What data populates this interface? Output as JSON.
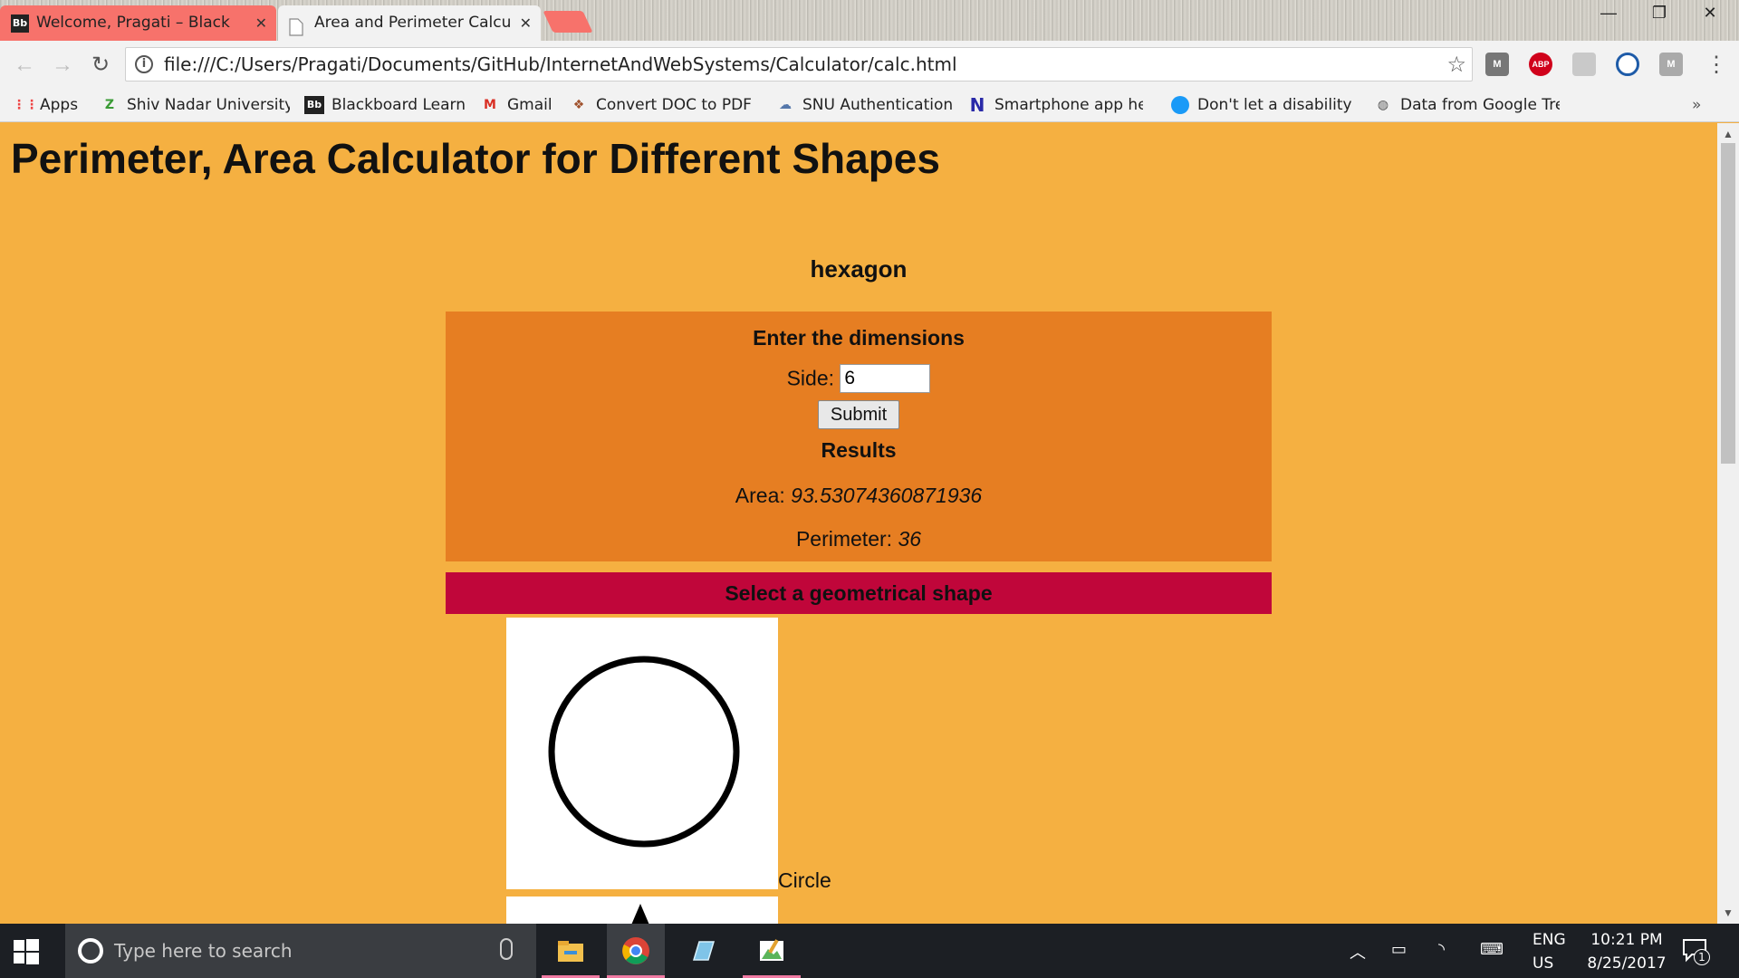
{
  "browser": {
    "tabs": [
      {
        "label": "Welcome, Pragati – Black",
        "favicon": "Bb"
      },
      {
        "label": "Area and Perimeter Calcu",
        "favicon": ""
      }
    ],
    "url": "file:///C:/Users/Pragati/Documents/GitHub/InternetAndWebSystems/Calculator/calc.html",
    "extensions": [
      "M",
      "ABP",
      "",
      "",
      "M"
    ],
    "bookmarks": [
      {
        "label": "Apps",
        "icon": "apps-grid-icon"
      },
      {
        "label": "Shiv Nadar University",
        "icon": "snu-logo-icon"
      },
      {
        "label": "Blackboard Learn",
        "icon": "blackboard-icon"
      },
      {
        "label": "Gmail",
        "icon": "gmail-icon"
      },
      {
        "label": "Convert DOC to PDF",
        "icon": "convert-icon"
      },
      {
        "label": "SNU Authentication",
        "icon": "cloud-icon"
      },
      {
        "label": "Smartphone app help",
        "icon": "n-logo-icon"
      },
      {
        "label": "Don't let a disability s",
        "icon": "blue-dot-icon"
      },
      {
        "label": "Data from Google Tre",
        "icon": "globe-icon"
      }
    ],
    "bookmarks_overflow": "»"
  },
  "page": {
    "title": "Perimeter, Area Calculator for Different Shapes",
    "shape_name": "hexagon",
    "dimensions_heading": "Enter the dimensions",
    "side_label": "Side:",
    "side_value": "6",
    "submit_label": "Submit",
    "results_heading": "Results",
    "area_label": "Area:",
    "area_value": "93.53074360871936",
    "perimeter_label": "Perimeter:",
    "perimeter_value": "36",
    "shape_bar_label": "Select a geometrical shape",
    "circle_label": "Circle"
  },
  "taskbar": {
    "search_placeholder": "Type here to search",
    "lang_line1": "ENG",
    "lang_line2": "US",
    "time": "10:21 PM",
    "date": "8/25/2017",
    "notification_count": "1"
  },
  "colors": {
    "page_bg": "#f5b041",
    "panel_bg": "#e67e22",
    "shape_bar_bg": "#c0063a",
    "taskbar_bg": "#1c1f24"
  }
}
